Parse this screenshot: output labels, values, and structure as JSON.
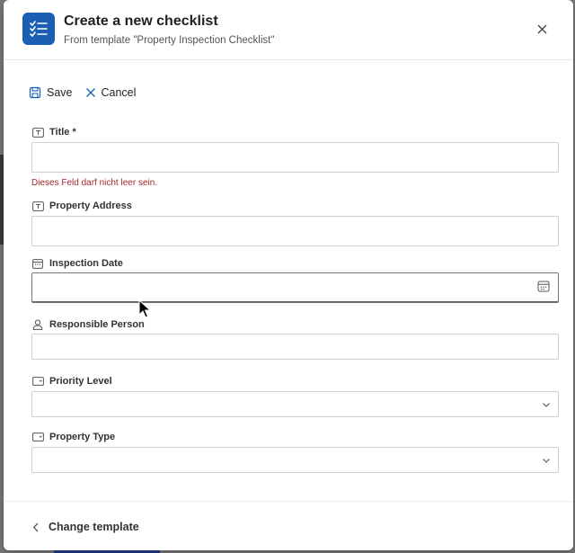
{
  "dialog": {
    "title": "Create a new checklist",
    "subtitle": "From template \"Property Inspection Checklist\""
  },
  "toolbar": {
    "save_label": "Save",
    "cancel_label": "Cancel"
  },
  "fields": {
    "title": {
      "label": "Title *",
      "value": "",
      "error": "Dieses Feld darf nicht leer sein."
    },
    "property_address": {
      "label": "Property Address",
      "value": ""
    },
    "inspection_date": {
      "label": "Inspection Date",
      "value": ""
    },
    "responsible_person": {
      "label": "Responsible Person",
      "value": ""
    },
    "priority_level": {
      "label": "Priority Level",
      "value": ""
    },
    "property_type": {
      "label": "Property Type",
      "value": ""
    }
  },
  "footer": {
    "change_template_label": "Change template"
  },
  "colors": {
    "accent": "#1a5fb4",
    "error": "#a4262c"
  },
  "icons": {
    "app": "checklist-icon",
    "close": "close-icon",
    "save": "save-icon",
    "cancel": "cancel-icon",
    "text_field": "text-field-icon",
    "calendar": "calendar-icon",
    "person": "person-icon",
    "choice": "choice-field-icon",
    "chevron_down": "chevron-down-icon",
    "chevron_left": "chevron-left-icon"
  }
}
